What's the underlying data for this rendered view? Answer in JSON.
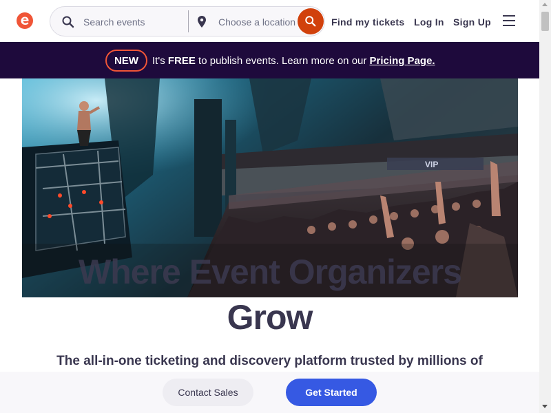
{
  "header": {
    "logo_icon": "eventbrite-logo-icon",
    "search_icon": "search-icon",
    "search_placeholder": "Search events",
    "location_icon": "map-pin-icon",
    "location_placeholder": "Choose a location",
    "find_tickets": "Find my tickets",
    "log_in": "Log In",
    "sign_up": "Sign Up",
    "menu_icon": "hamburger-menu-icon"
  },
  "banner": {
    "badge": "NEW",
    "text_prefix": "It's ",
    "text_bold": "FREE",
    "text_suffix": " to publish events. Learn more on our ",
    "link": "Pricing Page."
  },
  "hero": {
    "title_line1": "Where Event Organizers",
    "title_line2": "Grow",
    "subtitle": "The all-in-one ticketing and discovery platform trusted by millions of"
  },
  "cta": {
    "contact_sales": "Contact Sales",
    "get_started": "Get Started"
  },
  "colors": {
    "brand_orange": "#d1410c",
    "banner_bg": "#1e0a3c",
    "badge_border": "#f05537",
    "primary_blue": "#3659e3",
    "text_dark": "#39364f"
  }
}
